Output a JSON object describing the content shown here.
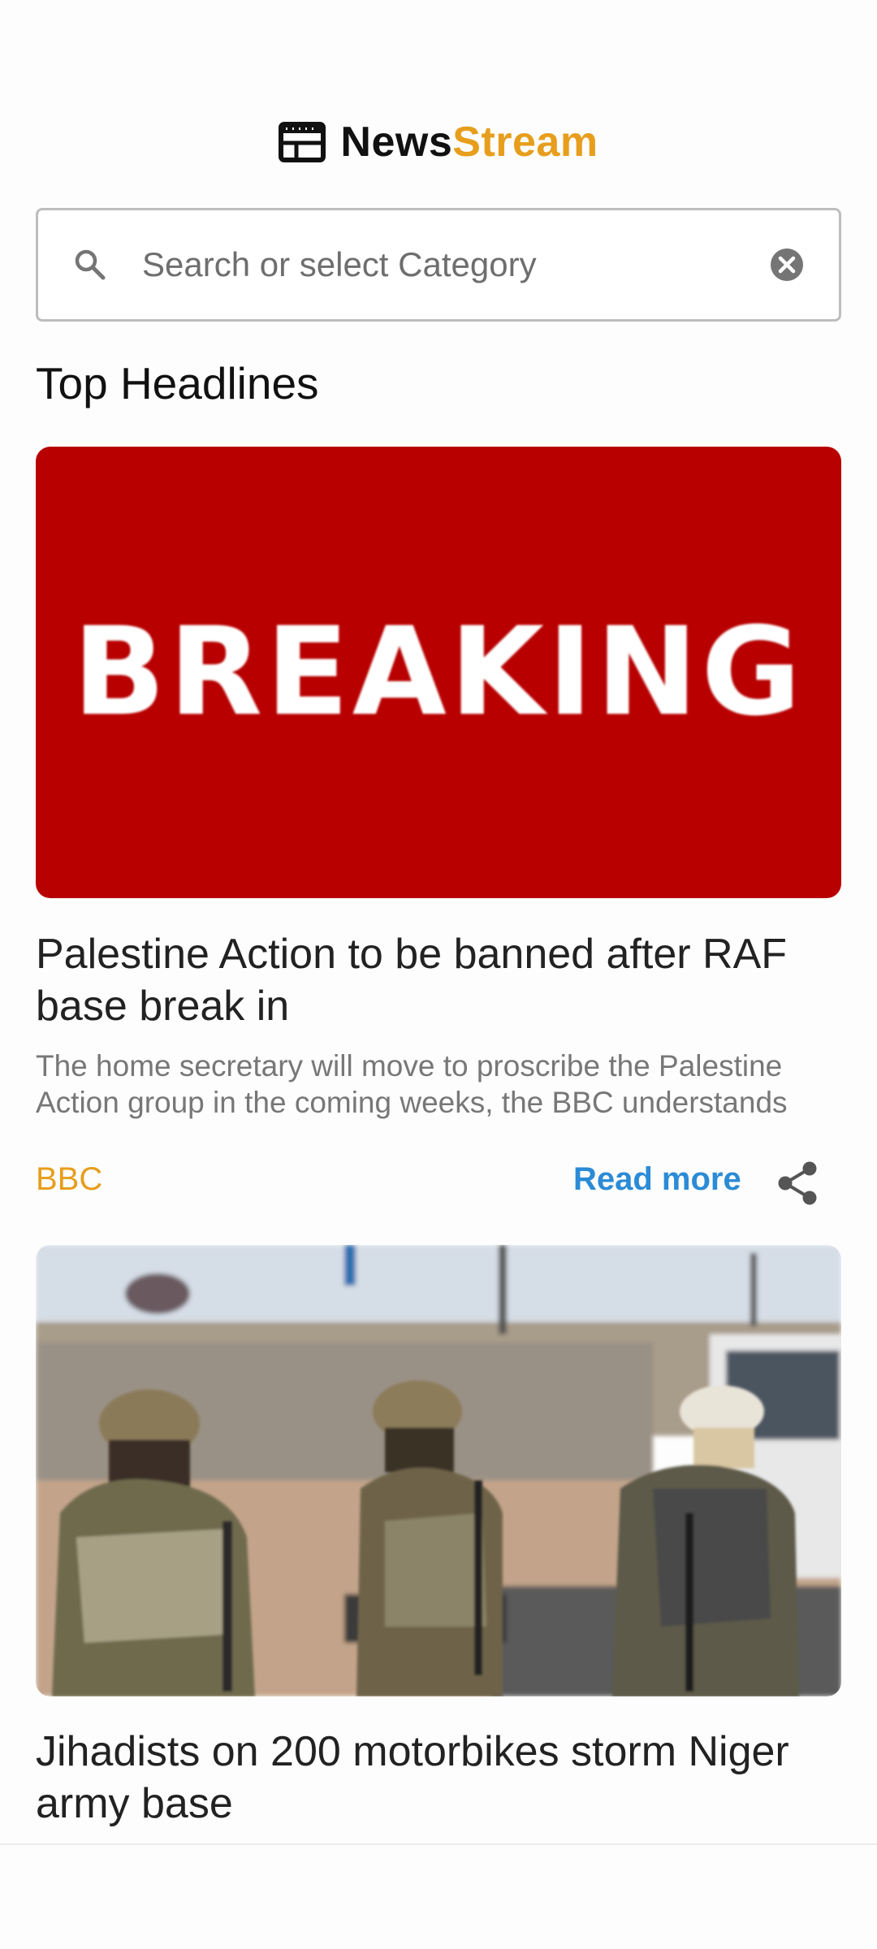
{
  "app": {
    "brand_part1": "News",
    "brand_part2": "Stream",
    "logo_icon": "newspaper-icon",
    "accent_color": "#e79e1d"
  },
  "search": {
    "placeholder": "Search or select Category",
    "value": "",
    "left_icon": "search-icon",
    "right_icon": "clear-icon"
  },
  "section": {
    "title": "Top Headlines"
  },
  "articles": [
    {
      "image_text": "BREAKING",
      "image_color": "#b80000",
      "headline": "Palestine Action to be banned after RAF base break in",
      "description": "The home secretary will move to proscribe the Palestine Action group in the coming weeks, the BBC understands",
      "source": "BBC",
      "read_more": "Read more",
      "share_icon": "share-icon"
    },
    {
      "image_text": "",
      "headline": "Jihadists on 200 motorbikes storm Niger army base"
    }
  ]
}
